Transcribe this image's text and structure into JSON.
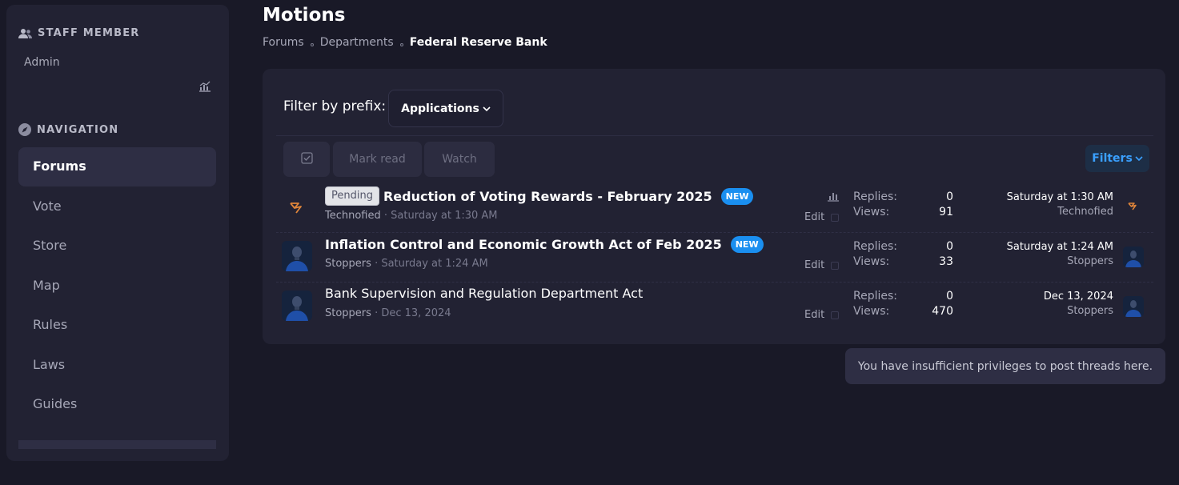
{
  "sidebar": {
    "staff_heading": "STAFF MEMBER",
    "admin_label": "Admin",
    "nav_heading": "NAVIGATION",
    "items": [
      {
        "label": "Forums",
        "active": true
      },
      {
        "label": "Vote"
      },
      {
        "label": "Store"
      },
      {
        "label": "Map"
      },
      {
        "label": "Rules"
      },
      {
        "label": "Laws"
      },
      {
        "label": "Guides"
      }
    ]
  },
  "header": {
    "title": "Motions",
    "breadcrumb": [
      "Forums",
      "Departments",
      "Federal Reserve Bank"
    ]
  },
  "toolbar": {
    "filter_label": "Filter by prefix:",
    "prefix_value": "Applications",
    "mark_read": "Mark read",
    "watch": "Watch",
    "filters": "Filters"
  },
  "threads": [
    {
      "prefix": "Pending",
      "title": "Reduction of Voting Rewards - February 2025",
      "is_new": "NEW",
      "author": "Technofied",
      "date": "Saturday at 1:30 AM",
      "edit": "Edit",
      "replies_label": "Replies:",
      "replies": "0",
      "views_label": "Views:",
      "views": "91",
      "last_date": "Saturday at 1:30 AM",
      "last_user": "Technofied"
    },
    {
      "title": "Inflation Control and Economic Growth Act of Feb 2025",
      "is_new": "NEW",
      "author": "Stoppers",
      "date": "Saturday at 1:24 AM",
      "edit": "Edit",
      "replies_label": "Replies:",
      "replies": "0",
      "views_label": "Views:",
      "views": "33",
      "last_date": "Saturday at 1:24 AM",
      "last_user": "Stoppers"
    },
    {
      "title": "Bank Supervision and Regulation Department Act",
      "author": "Stoppers",
      "date": "Dec 13, 2024",
      "edit": "Edit",
      "replies_label": "Replies:",
      "replies": "0",
      "views_label": "Views:",
      "views": "470",
      "last_date": "Dec 13, 2024",
      "last_user": "Stoppers"
    }
  ],
  "notice": "You have insufficient privileges to post threads here.",
  "meta_separator": " · ",
  "colors": {
    "background": "#191927",
    "panel": "#222233",
    "accent": "#1a8ff0",
    "technofied_icon": "#e0853a"
  }
}
